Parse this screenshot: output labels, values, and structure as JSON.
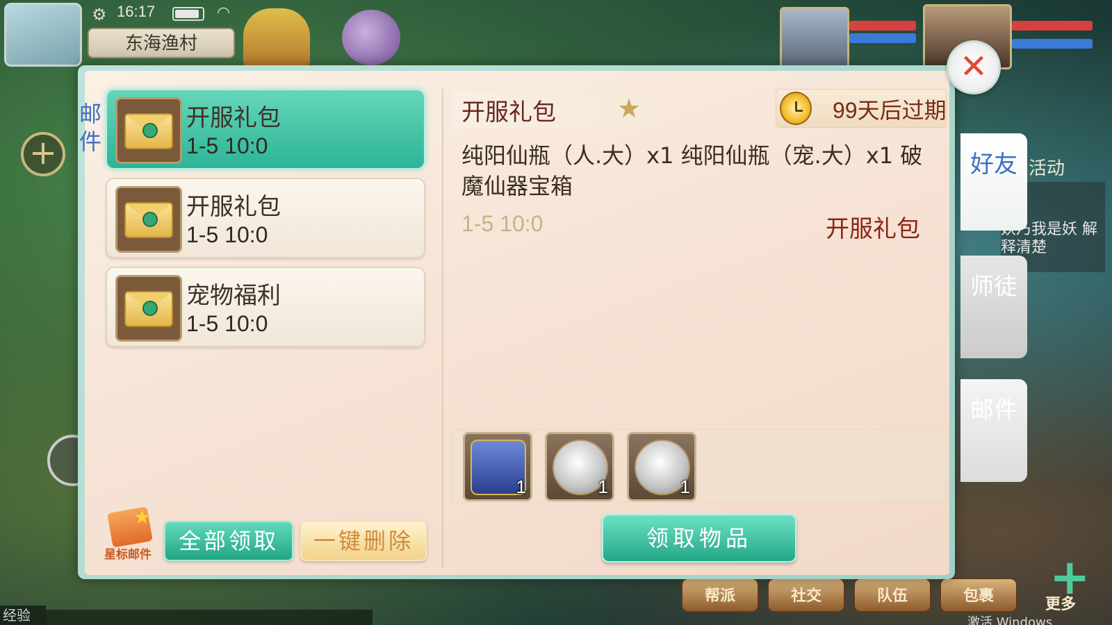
{
  "status": {
    "time": "16:17"
  },
  "location": "东海渔村",
  "side_label": "邮件",
  "mail_list": [
    {
      "title": "开服礼包",
      "date": "1-5 10:0",
      "selected": true
    },
    {
      "title": "开服礼包",
      "date": "1-5 10:0",
      "selected": false
    },
    {
      "title": "宠物福利",
      "date": "1-5 10:0",
      "selected": false
    }
  ],
  "footer": {
    "star_mail_label": "星标邮件",
    "claim_all_label": "全部领取",
    "delete_all_label": "一键删除"
  },
  "detail": {
    "title": "开服礼包",
    "expire": "99天后过期",
    "body": "纯阳仙瓶（人.大）x1 纯阳仙瓶（宠.大）x1 破魔仙器宝箱",
    "date": "1-5 10:0",
    "sender": "开服礼包",
    "items": [
      {
        "icon": "treasure-chest-icon",
        "count": "1"
      },
      {
        "icon": "vase-icon",
        "count": "1"
      },
      {
        "icon": "vase-icon",
        "count": "1"
      }
    ],
    "receive_label": "领取物品"
  },
  "tabs": [
    {
      "label": "好友"
    },
    {
      "label": "师徒"
    },
    {
      "label": "邮件"
    }
  ],
  "background": {
    "activity_label": "活动",
    "bubble_text": "妖乃我是妖 解释清楚",
    "exp_label": "经验",
    "bottom_buttons": [
      "帮派",
      "社交",
      "队伍",
      "包裹"
    ],
    "more_label": "更多",
    "watermark": "激活 Windows"
  },
  "colors": {
    "accent_teal": "#2db497",
    "title_red": "#8a2614",
    "close_red": "#e0473a"
  }
}
